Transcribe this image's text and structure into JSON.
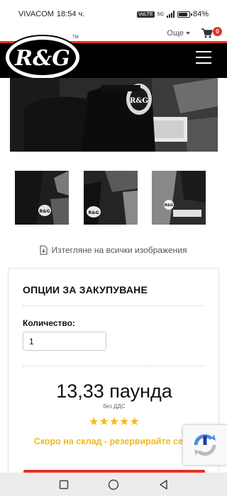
{
  "status_bar": {
    "carrier": "VIVACOM",
    "time": "18:54 ч.",
    "volte": "VoLTE",
    "network": "5G",
    "battery": "84%",
    "battery_level": 0.84
  },
  "header": {
    "more_label": "Още",
    "cart_count": "0",
    "logo_text": "R&G",
    "trademark": "TM"
  },
  "gallery": {
    "main_image_mark": "R&G",
    "thumb_marks": [
      "R&G",
      "R&G",
      "R&G"
    ],
    "download_label": "Изтегляне на всички изображения"
  },
  "purchase": {
    "title": "ОПЦИИ ЗА ЗАКУПУВАНЕ",
    "quantity_label": "Количество:",
    "quantity_value": "1",
    "price": "13,33 паунда",
    "vat_note": "без ДДС",
    "rating_stars": 5,
    "availability": "Скоро на склад - резервирайте сега!"
  },
  "colors": {
    "brand_red": "#e53229",
    "star_gold": "#f3b91c",
    "nav_black": "#000000"
  },
  "system_nav": {
    "icons": [
      "recents-icon",
      "home-icon",
      "back-icon"
    ]
  }
}
